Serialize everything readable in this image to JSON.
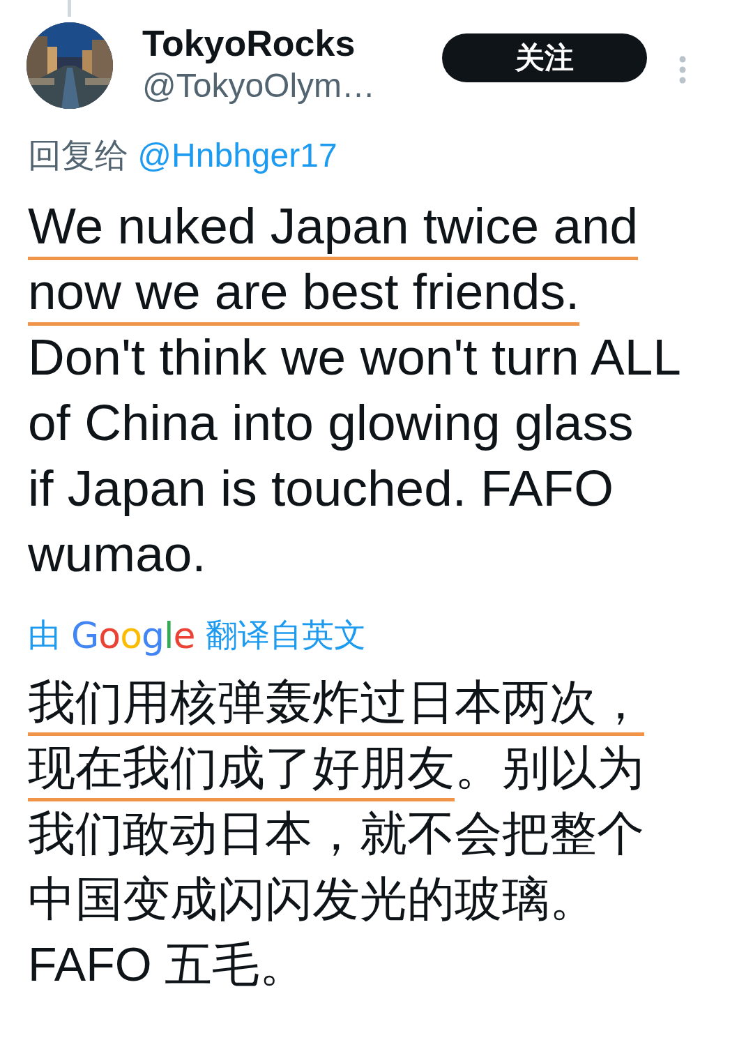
{
  "author": {
    "name": "TokyoRocks",
    "handle": "@TokyoOlym…"
  },
  "follow_button": {
    "label": "关注"
  },
  "reply_to": {
    "prefix": "回复给",
    "mention": "@Hnbhger17"
  },
  "body_lines": [
    {
      "segments": [
        {
          "text": "We nuked Japan twice and",
          "underlined": true
        }
      ]
    },
    {
      "segments": [
        {
          "text": "now we are best friends.",
          "underlined": true
        }
      ]
    },
    {
      "segments": [
        {
          "text": "Don't think we won't turn ALL",
          "underlined": false
        }
      ]
    },
    {
      "segments": [
        {
          "text": "of China into glowing glass",
          "underlined": false
        }
      ]
    },
    {
      "segments": [
        {
          "text": "if Japan is touched. FAFO",
          "underlined": false
        }
      ]
    },
    {
      "segments": [
        {
          "text": "wumao.",
          "underlined": false
        }
      ]
    }
  ],
  "translation_note": {
    "prefix": "由",
    "brand": "Google",
    "suffix": "翻译自英文"
  },
  "translated_lines": [
    {
      "segments": [
        {
          "text": "我们用核弹轰炸过日本两次，",
          "underlined": true
        }
      ]
    },
    {
      "segments": [
        {
          "text": "现在我们成了好朋友",
          "underlined": true
        },
        {
          "text": "。别以为",
          "underlined": false
        }
      ]
    },
    {
      "segments": [
        {
          "text": "我们敢动日本，就不会把整个",
          "underlined": false
        }
      ]
    },
    {
      "segments": [
        {
          "text": "中国变成闪闪发光的玻璃。",
          "underlined": false
        }
      ]
    },
    {
      "segments": [
        {
          "text": "FAFO 五毛。",
          "underlined": false
        }
      ]
    }
  ]
}
